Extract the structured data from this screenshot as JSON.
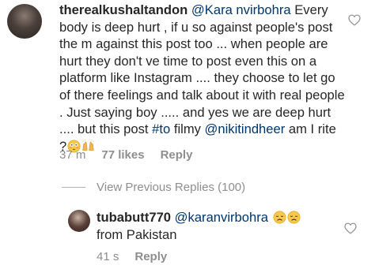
{
  "comment": {
    "username": "therealkushaltandon",
    "mention_1": "@Kara nvirbohra",
    "text_part_1": " Every body is deep hurt , if u so against people's post the m against this post too ... when people are hurt they don't ve time to post even this on a platform like Instagram .... they choose to let go of there feelings and talk about it with real people . Just saying boy ..... and yes we are deep hurt .... but this post ",
    "hashtag": "#to",
    "text_part_2": " filmy ",
    "mention_2": "@nikitindheer",
    "text_part_3": " am I rite ?",
    "emojis": [
      "flushed-face-emoji",
      "raising-hands-emoji"
    ],
    "time": "37 m",
    "likes": "77 likes",
    "reply_label": "Reply"
  },
  "view_replies": {
    "label": "View Previous Replies (100)"
  },
  "reply": {
    "username": "tubabutt770",
    "mention": "@karanvirbohra",
    "emojis": [
      "disappointed-face-emoji",
      "disappointed-face-emoji"
    ],
    "text": "from Pakistan",
    "time": "41 s",
    "reply_label": "Reply"
  },
  "icons": {
    "like": "heart-outline-icon"
  },
  "colors": {
    "text": "#262626",
    "meta": "#8e8e8e",
    "link": "#003569"
  }
}
